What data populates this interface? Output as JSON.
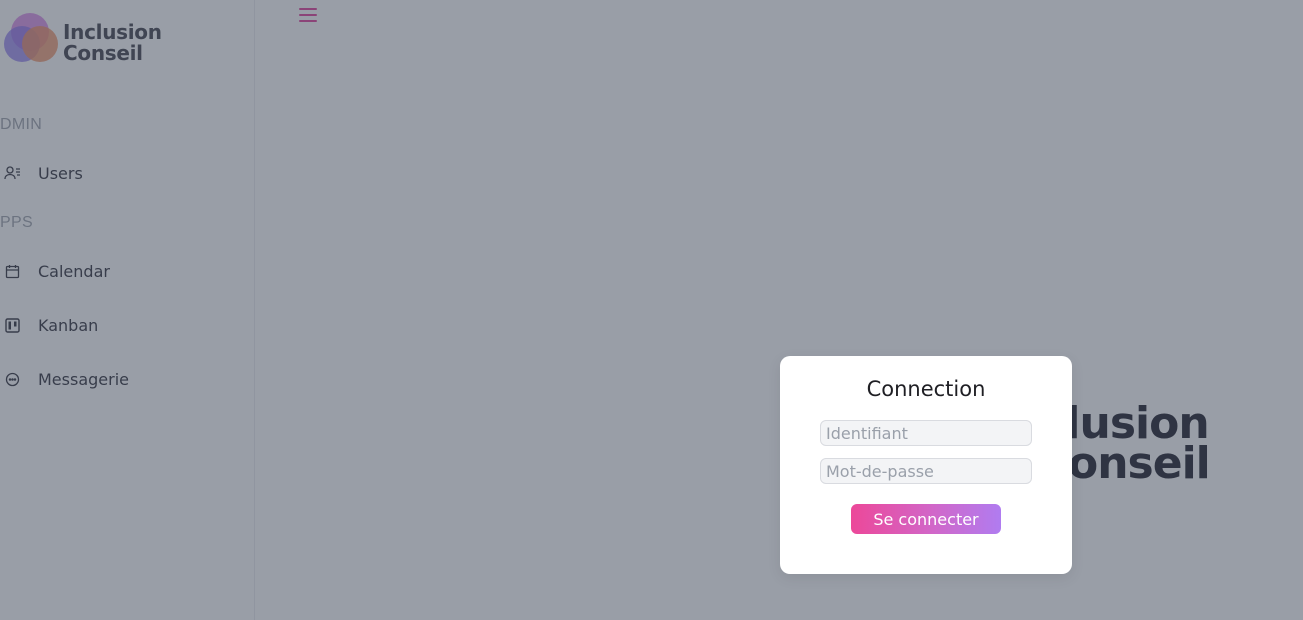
{
  "brand": {
    "line1": "Inclusion",
    "line2": "Conseil"
  },
  "sidebar": {
    "sections": [
      {
        "title": "DMIN",
        "items": [
          {
            "label": "Users",
            "icon": "users-icon"
          }
        ]
      },
      {
        "title": "PPS",
        "items": [
          {
            "label": "Calendar",
            "icon": "calendar-icon"
          },
          {
            "label": "Kanban",
            "icon": "kanban-icon"
          },
          {
            "label": "Messagerie",
            "icon": "chat-icon"
          }
        ]
      }
    ]
  },
  "header": {
    "menu_icon": "hamburger-icon",
    "accent": "#e24aa0"
  },
  "background_logo": {
    "line1": "nclusion",
    "line2": "onseil"
  },
  "login": {
    "title": "Connection",
    "username": {
      "value": "",
      "placeholder": "Identifiant"
    },
    "password": {
      "value": "",
      "placeholder": "Mot-de-passe"
    },
    "submit_label": "Se connecter",
    "button_gradient": [
      "#ec4899",
      "#b07cf0"
    ]
  },
  "colors": {
    "overlay": "#343d50",
    "logo_circle_1": "#c77fe0",
    "logo_circle_2": "#8b6fe8",
    "logo_circle_3": "#f08a5d"
  }
}
